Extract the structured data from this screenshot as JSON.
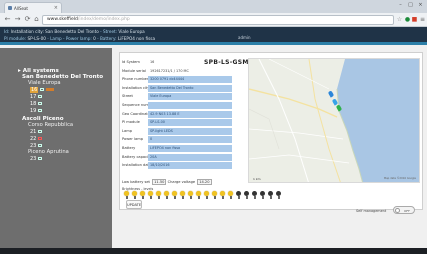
{
  "browser": {
    "tab_title": "AllSeat",
    "close_glyph": "×",
    "window_buttons": [
      "–",
      "□",
      "×"
    ],
    "url_host": "www.skeffield",
    "url_path": "/index/demo/index.php",
    "nav_icons": [
      "back-icon",
      "forward-icon",
      "reload-icon",
      "home-icon"
    ],
    "toolbar_icons": [
      "star-icon",
      "extension-icon",
      "extension-icon",
      "menu-icon"
    ]
  },
  "header": {
    "line1_parts": [
      "Id: ",
      "Installation city: San Benedetto Del Tronto",
      " - Street: ",
      "Viale Europa"
    ],
    "line2_parts": [
      "Pl module: ",
      "SP-LS-00",
      " - Lamp - ",
      "Power lamp: ",
      "0",
      " - Battery: ",
      "LiFEPO4 non fissa"
    ],
    "right": "admin"
  },
  "sidebar": {
    "root": "All systems",
    "groups": [
      {
        "name": "San Benedetto Del Tronto",
        "streets": [
          {
            "name": "Viale Europa",
            "lamps": [
              {
                "num": "16",
                "selected": true,
                "status": "ok",
                "bar": true
              },
              {
                "num": "17",
                "selected": false,
                "status": "ok",
                "bar": false
              },
              {
                "num": "18",
                "selected": false,
                "status": "ok",
                "bar": false
              },
              {
                "num": "19",
                "selected": false,
                "status": "ok",
                "bar": false
              }
            ]
          }
        ]
      },
      {
        "name": "Ascoli Piceno",
        "streets": [
          {
            "name": "Corso Repubblica",
            "lamps": [
              {
                "num": "21",
                "selected": false,
                "status": "ok",
                "bar": false
              },
              {
                "num": "22",
                "selected": false,
                "status": "red",
                "bar": false
              },
              {
                "num": "23",
                "selected": false,
                "status": "ok",
                "bar": false
              }
            ]
          },
          {
            "name": "Piceno Aprutina",
            "lamps": [
              {
                "num": "23",
                "selected": false,
                "status": "ok",
                "bar": false
              }
            ]
          }
        ]
      }
    ]
  },
  "panel": {
    "title": "SPB-LS-GSM",
    "fields": [
      {
        "label": "Id System",
        "value": "16",
        "style": "plain"
      },
      {
        "label": "Module serial",
        "value": "192617231/1 / 170 MC",
        "style": "plain"
      },
      {
        "label": "Phone number",
        "value": "3200 0791 dc44444",
        "style": "blue"
      },
      {
        "label": "Installation city",
        "value": "San Benedetto Del Tronto",
        "style": "blue"
      },
      {
        "label": "Street",
        "value": "Viale Europa",
        "style": "blue"
      },
      {
        "label": "Sequence number",
        "value": "",
        "style": "blue"
      },
      {
        "label": "Geo Coordinates",
        "value": "42.9 N03 13.88 E",
        "style": "blue"
      },
      {
        "label": "Pl module",
        "value": "SP-LS-00",
        "style": "blue"
      },
      {
        "label": "Lamp",
        "value": "SP-light LEDS",
        "style": "blue"
      },
      {
        "label": "Power lamp",
        "value": "0",
        "style": "blue"
      },
      {
        "label": "Battery",
        "value": "LiFEPO4 non fissa",
        "style": "blue"
      },
      {
        "label": "Battery capacity",
        "value": "20A",
        "style": "blue"
      },
      {
        "label": "Installation date",
        "value": "18/10/2016",
        "style": "blue"
      },
      {
        "label": "Low battery set",
        "value": "",
        "style": "plain"
      }
    ],
    "lamp_set": {
      "label": "Low battery set",
      "v1": "11.50",
      "mid": "Charge voltage",
      "v2": "14.20"
    },
    "bulbs_label": "Brightness - levels",
    "bulbs": [
      1,
      1,
      1,
      1,
      1,
      1,
      1,
      1,
      1,
      1,
      1,
      1,
      1,
      1,
      0,
      0,
      0,
      0,
      0,
      0
    ],
    "update_label": "UPDATE",
    "self_management_label": "Self management",
    "toggle_text": "OFF"
  },
  "map": {
    "scale_label": "1 km",
    "credit": "Map data ©2016 Google",
    "marker_colors": [
      "#2b86d9",
      "#38a3e8",
      "#2eb04a"
    ]
  }
}
